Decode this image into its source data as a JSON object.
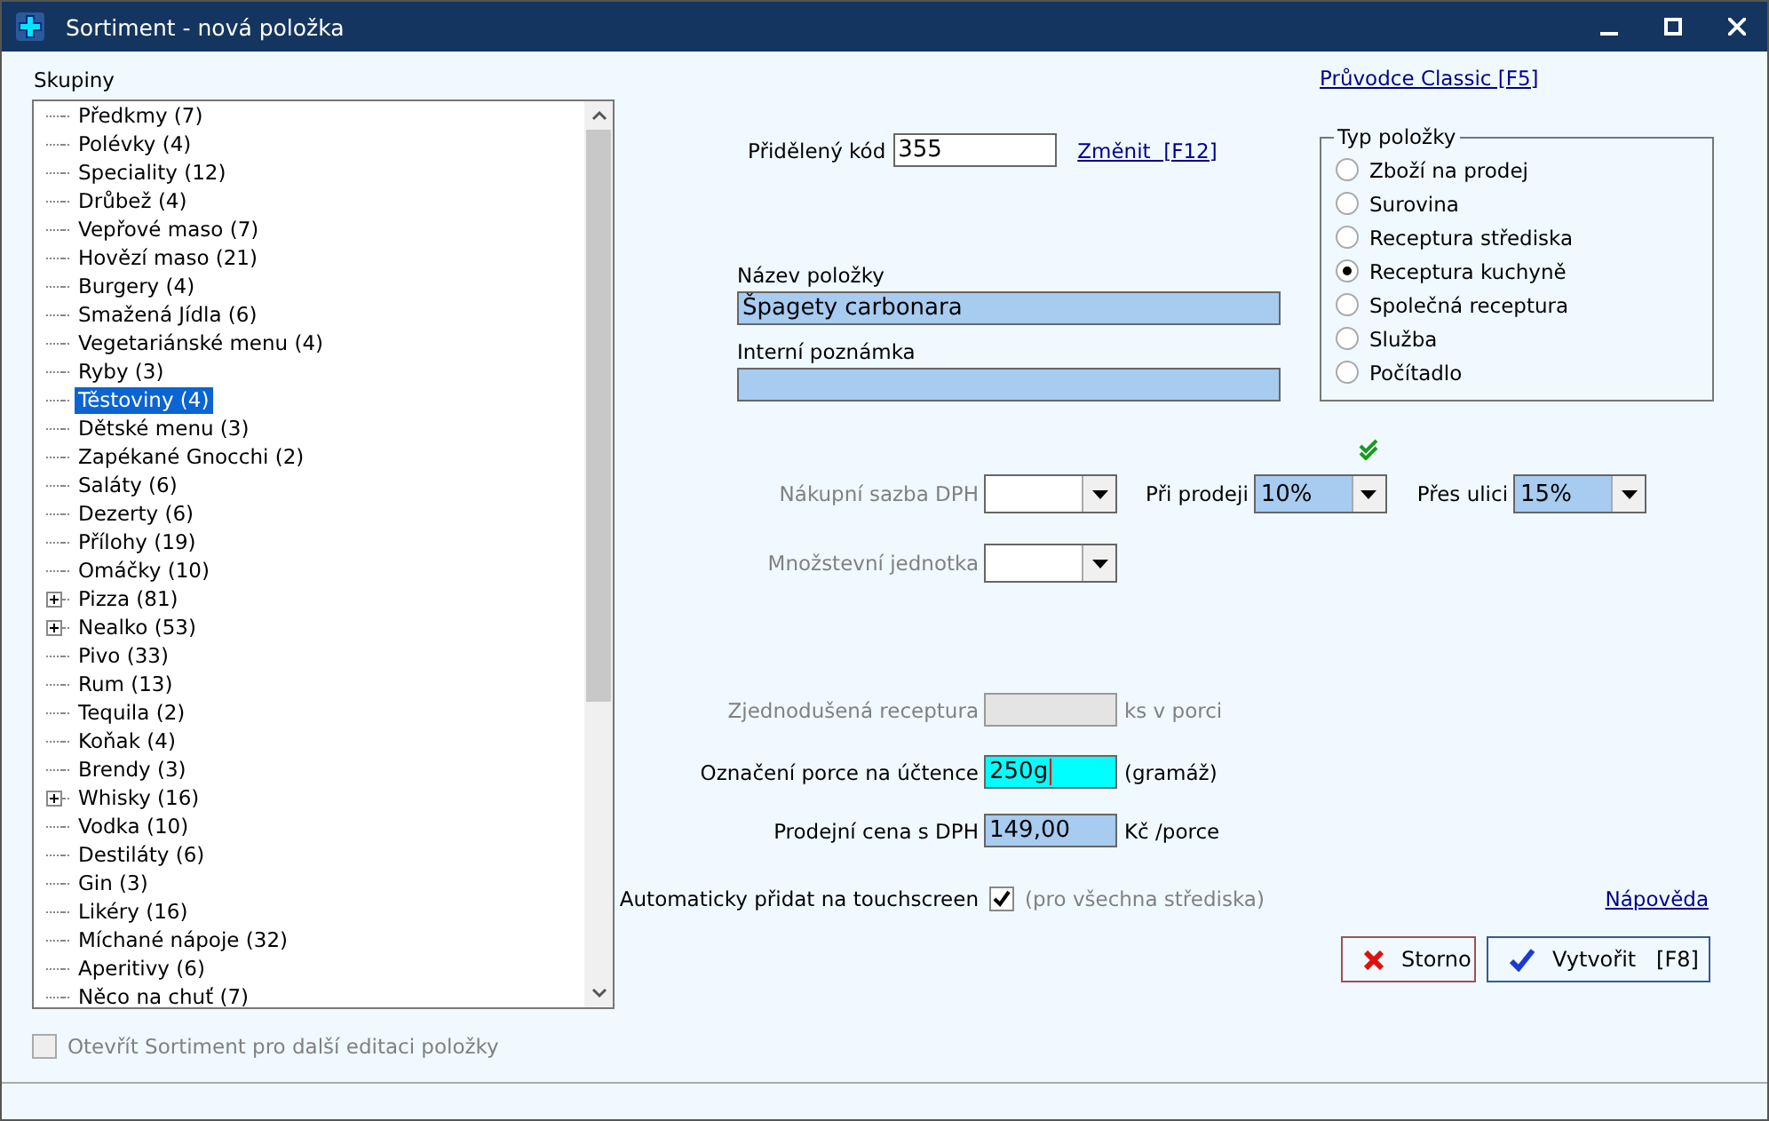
{
  "window": {
    "title": "Sortiment - nová položka"
  },
  "groups": {
    "label": "Skupiny",
    "items": [
      {
        "label": "Předkmy (7)",
        "expandable": false,
        "selected": false
      },
      {
        "label": "Polévky (4)",
        "expandable": false,
        "selected": false
      },
      {
        "label": "Speciality (12)",
        "expandable": false,
        "selected": false
      },
      {
        "label": "Drůbež (4)",
        "expandable": false,
        "selected": false
      },
      {
        "label": "Vepřové maso (7)",
        "expandable": false,
        "selected": false
      },
      {
        "label": "Hovězí maso (21)",
        "expandable": false,
        "selected": false
      },
      {
        "label": "Burgery (4)",
        "expandable": false,
        "selected": false
      },
      {
        "label": "Smažená Jídla (6)",
        "expandable": false,
        "selected": false
      },
      {
        "label": "Vegetariánské menu (4)",
        "expandable": false,
        "selected": false
      },
      {
        "label": "Ryby (3)",
        "expandable": false,
        "selected": false
      },
      {
        "label": "Těstoviny (4)",
        "expandable": false,
        "selected": true
      },
      {
        "label": "Dětské menu (3)",
        "expandable": false,
        "selected": false
      },
      {
        "label": "Zapékané Gnocchi (2)",
        "expandable": false,
        "selected": false
      },
      {
        "label": "Saláty (6)",
        "expandable": false,
        "selected": false
      },
      {
        "label": "Dezerty (6)",
        "expandable": false,
        "selected": false
      },
      {
        "label": "Přílohy (19)",
        "expandable": false,
        "selected": false
      },
      {
        "label": "Omáčky (10)",
        "expandable": false,
        "selected": false
      },
      {
        "label": "Pizza (81)",
        "expandable": true,
        "selected": false
      },
      {
        "label": "Nealko (53)",
        "expandable": true,
        "selected": false
      },
      {
        "label": "Pivo (33)",
        "expandable": false,
        "selected": false
      },
      {
        "label": "Rum (13)",
        "expandable": false,
        "selected": false
      },
      {
        "label": "Tequila (2)",
        "expandable": false,
        "selected": false
      },
      {
        "label": "Koňak (4)",
        "expandable": false,
        "selected": false
      },
      {
        "label": "Brendy (3)",
        "expandable": false,
        "selected": false
      },
      {
        "label": "Whisky (16)",
        "expandable": true,
        "selected": false
      },
      {
        "label": "Vodka (10)",
        "expandable": false,
        "selected": false
      },
      {
        "label": "Destiláty (6)",
        "expandable": false,
        "selected": false
      },
      {
        "label": "Gin (3)",
        "expandable": false,
        "selected": false
      },
      {
        "label": "Likéry (16)",
        "expandable": false,
        "selected": false
      },
      {
        "label": "Míchané nápoje (32)",
        "expandable": false,
        "selected": false
      },
      {
        "label": "Aperitivy (6)",
        "expandable": false,
        "selected": false
      },
      {
        "label": "Něco na chuť (7)",
        "expandable": false,
        "selected": false
      }
    ]
  },
  "open_after": {
    "label": "Otevřít Sortiment pro další editaci položky",
    "checked": false,
    "disabled": true
  },
  "wizard_link": "Průvodce Classic [F5]",
  "code": {
    "label": "Přidělený kód",
    "value": "355",
    "change_link": "Změnit  [F12]"
  },
  "name": {
    "label": "Název položky",
    "value": "Špagety carbonara"
  },
  "note": {
    "label": "Interní poznámka"
  },
  "item_type": {
    "label": "Typ položky",
    "options": [
      {
        "label": "Zboží na prodej",
        "selected": false
      },
      {
        "label": "Surovina",
        "selected": false
      },
      {
        "label": "Receptura střediska",
        "selected": false
      },
      {
        "label": "Receptura kuchyně",
        "selected": true
      },
      {
        "label": "Společná receptura",
        "selected": false
      },
      {
        "label": "Služba",
        "selected": false
      },
      {
        "label": "Počítadlo",
        "selected": false
      }
    ]
  },
  "purchase_vat": {
    "label": "Nákupní sazba DPH",
    "disabled": true
  },
  "sale_vat": {
    "label": "Při prodeji",
    "value": "10%",
    "verified": true
  },
  "street_vat": {
    "label": "Přes ulici",
    "value": "15%"
  },
  "unit": {
    "label": "Množstevní jednotka",
    "disabled": true
  },
  "simplified_recipe": {
    "label": "Zjednodušená receptura",
    "suffix": "ks v porci",
    "disabled": true
  },
  "portion": {
    "label": "Označení porce na účtence",
    "value": "250g",
    "suffix": "(gramáž)",
    "focused": true
  },
  "price": {
    "label": "Prodejní cena s DPH",
    "value": "149,00",
    "suffix": "Kč /porce",
    "focused": false
  },
  "touchscreen": {
    "label": "Automaticky přidat na touchscreen",
    "checked": true,
    "note": "(pro všechna střediska)"
  },
  "help_link": "Nápověda",
  "buttons": [
    {
      "label": "Storno",
      "kind": "cancel"
    },
    {
      "label": "Vytvořit   [F8]",
      "kind": "create"
    }
  ]
}
